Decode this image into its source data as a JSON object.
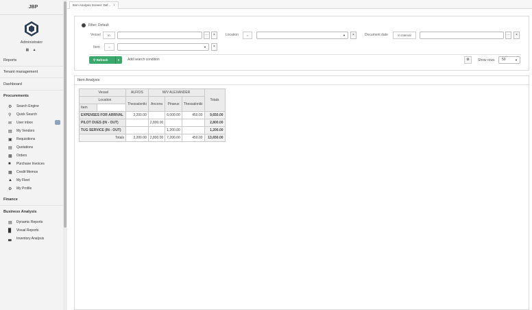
{
  "app": {
    "brand": "JBP"
  },
  "user": {
    "name": "Administrator"
  },
  "sidebar": {
    "sections": {
      "reports": "Reports",
      "tenant": "Tenant management",
      "dashboard": "Dashboard",
      "procurements": "Procurements",
      "finance": "Finance",
      "business": "Business Analysis"
    },
    "procurements": [
      {
        "label": "Search Engine",
        "icon": "gear-icon"
      },
      {
        "label": "Quick Search",
        "icon": "search-icon"
      },
      {
        "label": "User inbox",
        "icon": "inbox-icon"
      },
      {
        "label": "My Vendors",
        "icon": "vendors-icon"
      },
      {
        "label": "Requisitions",
        "icon": "requisition-icon"
      },
      {
        "label": "Quotations",
        "icon": "quotation-icon"
      },
      {
        "label": "Orders",
        "icon": "orders-icon"
      },
      {
        "label": "Purchase Invoices",
        "icon": "invoice-icon"
      },
      {
        "label": "Credit Memos",
        "icon": "memo-icon"
      },
      {
        "label": "My Fleet",
        "icon": "fleet-icon"
      },
      {
        "label": "My Profile",
        "icon": "profile-icon"
      }
    ],
    "business": [
      {
        "label": "Dynamic Reports",
        "icon": "report-icon"
      },
      {
        "label": "Visual Reports",
        "icon": "chart-icon"
      },
      {
        "label": "Inventory Analysis",
        "icon": "inventory-icon"
      }
    ]
  },
  "tab": {
    "label": "Item Analysis Screen: Def..."
  },
  "filter": {
    "title": "Filter: Default",
    "vessel_label": "Vessel",
    "vessel_op": "in",
    "location_label": "Location",
    "location_op": "=",
    "docdate_label": "Document date",
    "docdate_op": "in interval",
    "item_label": "Item",
    "item_op": "=",
    "refresh_label": "Refresh",
    "add_condition": "Add search condition",
    "show_rows_label": "Show rows",
    "show_rows_value": "50"
  },
  "result": {
    "title": "Item Analysis",
    "header": {
      "vessel": "Vessel",
      "location": "Location",
      "item": "Item",
      "totals": "Totals",
      "vessels": [
        "ALFIOS",
        "M/V ALEXANDER"
      ],
      "locations": [
        "Thessaloniki",
        "Ancona",
        "Piraeus",
        "Thessaloniki"
      ]
    },
    "rows": [
      {
        "item": "EXPENSES FOR ARRIVAL",
        "values": [
          "3,200.00",
          "",
          "6,000.00",
          "450.00"
        ],
        "total": "9,650.00"
      },
      {
        "item": "PILOT DUES (IN - OUT)",
        "values": [
          "",
          "2,800.00",
          "",
          ""
        ],
        "total": "2,800.00"
      },
      {
        "item": "TUG SERVICE (IN - OUT)",
        "values": [
          "",
          "",
          "1,200.00",
          ""
        ],
        "total": "1,200.00"
      }
    ],
    "totals": {
      "label": "Totals",
      "values": [
        "3,200.00",
        "2,800.00",
        "7,200.00",
        "450.00"
      ],
      "total": "13,650.00"
    }
  }
}
